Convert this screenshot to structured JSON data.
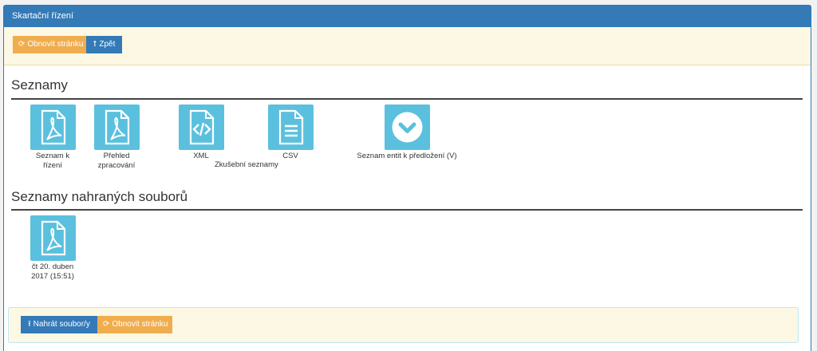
{
  "panel": {
    "title": "Skartační řízení"
  },
  "top_toolbar": {
    "refresh_label": "Obnovit stránku",
    "back_label": "Zpět",
    "refresh_icon": "refresh-icon",
    "back_icon": "arrow-up-icon"
  },
  "seznamy": {
    "heading": "Seznamy",
    "items": [
      {
        "label": "Seznam k řízení",
        "icon": "pdf-file-icon"
      },
      {
        "label": "Přehled zpracování",
        "icon": "pdf-file-icon"
      },
      {
        "label": "XML",
        "icon": "code-file-icon"
      },
      {
        "label": "CSV",
        "icon": "text-file-icon"
      },
      {
        "label": "Seznam entit k předložení (V)",
        "icon": "chevron-down-circle-icon"
      }
    ],
    "sublabel": "Zkušební seznamy"
  },
  "uploaded": {
    "heading": "Seznamy nahraných souborů",
    "items": [
      {
        "label": "čt 20. duben 2017 (15:51)",
        "icon": "pdf-file-icon"
      }
    ]
  },
  "bottom_toolbar": {
    "upload_label": "Nahrát soubor/y",
    "refresh_label": "Obnovit stránku",
    "upload_icon": "upload-icon",
    "refresh_icon": "refresh-icon"
  },
  "colors": {
    "primary": "#337ab7",
    "warning": "#f0ad4e",
    "info": "#5bc0de",
    "toolbar_bg": "#fcf8e3"
  }
}
